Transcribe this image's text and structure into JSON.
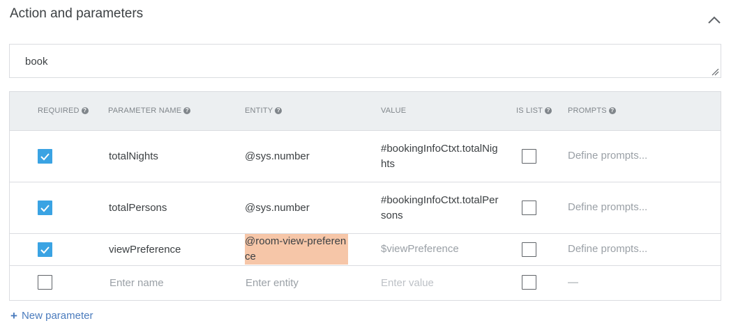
{
  "section": {
    "title": "Action and parameters"
  },
  "action": {
    "value": "book"
  },
  "table": {
    "headers": {
      "required": "REQUIRED",
      "parameter_name": "PARAMETER NAME",
      "entity": "ENTITY",
      "value": "VALUE",
      "is_list": "IS LIST",
      "prompts": "PROMPTS"
    },
    "help_glyph": "?",
    "rows": [
      {
        "required": true,
        "name": "totalNights",
        "entity": "@sys.number",
        "value": "#bookingInfoCtxt.totalNights",
        "is_list": false,
        "prompts": "Define prompts..."
      },
      {
        "required": true,
        "name": "totalPersons",
        "entity": "@sys.number",
        "value": "#bookingInfoCtxt.totalPersons",
        "is_list": false,
        "prompts": "Define prompts..."
      },
      {
        "required": true,
        "name": "viewPreference",
        "entity": "@room-view-preference",
        "value": "$viewPreference",
        "is_list": false,
        "prompts": "Define prompts..."
      }
    ],
    "new_row": {
      "required": false,
      "name_placeholder": "Enter name",
      "entity_placeholder": "Enter entity",
      "value_placeholder": "Enter value",
      "is_list": false,
      "prompts": "—"
    }
  },
  "new_parameter": {
    "plus": "+",
    "label": "New parameter"
  },
  "colors": {
    "checkbox": "#3aa3e3",
    "entity_highlight": "#f6c6a8",
    "link": "#4a7bbd",
    "header_bg": "#eceff1"
  }
}
